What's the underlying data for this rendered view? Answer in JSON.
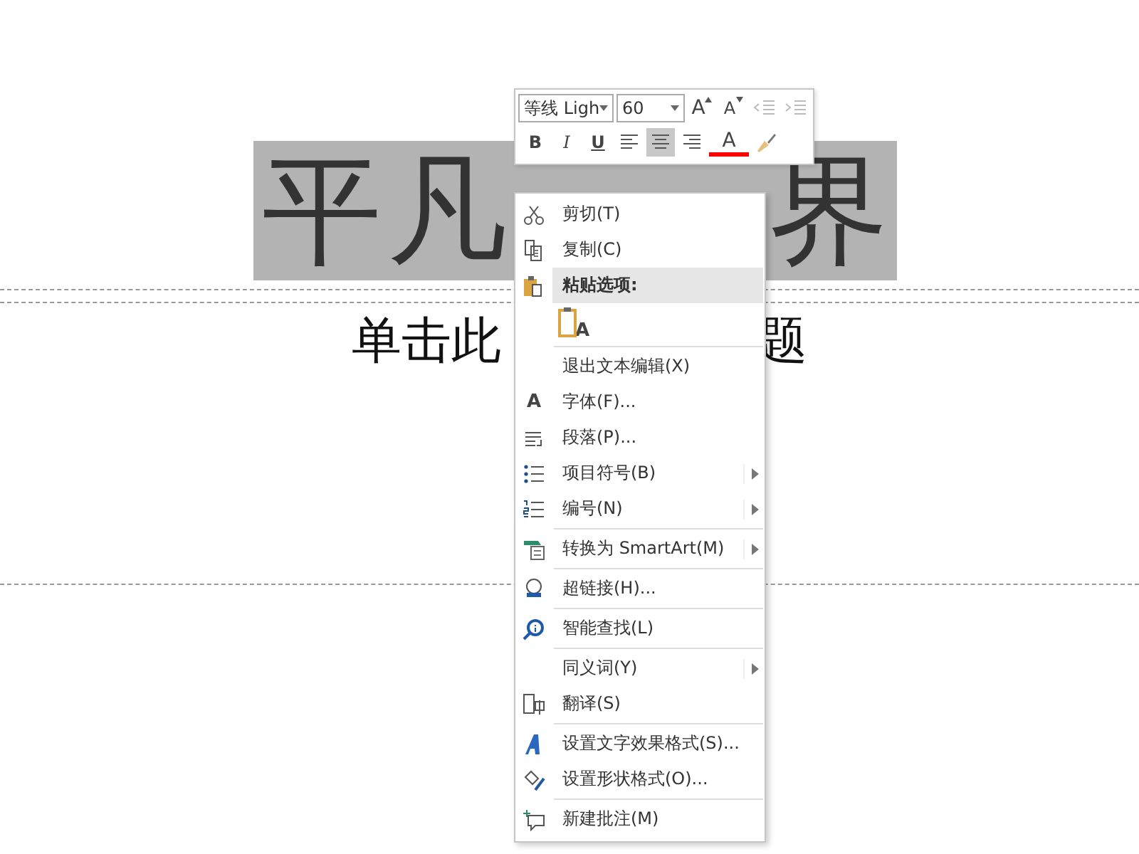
{
  "slide": {
    "title_left": "平凡",
    "title_right": "界",
    "title_selected": true,
    "subtitle_left": "单击此",
    "subtitle_right": "题"
  },
  "mini_toolbar": {
    "font_name": "等线 Ligh",
    "font_size": "60",
    "row_1": [
      {
        "kind": "grow",
        "label": "A",
        "disabled": false
      },
      {
        "kind": "shrink",
        "label": "A",
        "disabled": false
      },
      {
        "kind": "outdent",
        "disabled": true
      },
      {
        "kind": "indent",
        "disabled": true
      }
    ],
    "row_2": [
      {
        "kind": "bold",
        "label": "B",
        "selected": false
      },
      {
        "kind": "italic",
        "label": "I",
        "selected": false
      },
      {
        "kind": "underline",
        "label": "U",
        "selected": false
      },
      {
        "kind": "align-left",
        "selected": false
      },
      {
        "kind": "align-center",
        "selected": true
      },
      {
        "kind": "align-right",
        "selected": false
      },
      {
        "kind": "font-color",
        "label": "A",
        "color": "#ff0000"
      },
      {
        "kind": "painter"
      }
    ]
  },
  "context_menu": [
    {
      "kind": "item",
      "label": "剪切(T)",
      "submenu": false,
      "divider": false
    },
    {
      "kind": "item",
      "label": "复制(C)",
      "submenu": false,
      "divider": false
    },
    {
      "kind": "header",
      "label": "粘贴选项:",
      "divider": false
    },
    {
      "kind": "paste-option",
      "label": "A",
      "divider": false
    },
    {
      "kind": "item",
      "label": "退出文本编辑(X)",
      "submenu": false,
      "divider": true
    },
    {
      "kind": "item",
      "glyph": "A",
      "label": "字体(F)...",
      "submenu": false,
      "divider": false
    },
    {
      "kind": "item",
      "label": "段落(P)...",
      "submenu": false,
      "divider": false
    },
    {
      "kind": "item",
      "label": "项目符号(B)",
      "submenu": true,
      "divider": false
    },
    {
      "kind": "item",
      "label": "编号(N)",
      "submenu": true,
      "divider": false
    },
    {
      "kind": "item",
      "label": "转换为 SmartArt(M)",
      "submenu": true,
      "divider": true
    },
    {
      "kind": "item",
      "label": "超链接(H)...",
      "submenu": false,
      "divider": true
    },
    {
      "kind": "item",
      "label": "智能查找(L)",
      "submenu": false,
      "divider": true
    },
    {
      "kind": "item",
      "label": "同义词(Y)",
      "submenu": true,
      "divider": true
    },
    {
      "kind": "item",
      "label": "翻译(S)",
      "submenu": false,
      "divider": false
    },
    {
      "kind": "item",
      "label": "设置文字效果格式(S)...",
      "submenu": false,
      "divider": true
    },
    {
      "kind": "item",
      "label": "设置形状格式(O)...",
      "submenu": false,
      "divider": false
    },
    {
      "kind": "item",
      "label": "新建批注(M)",
      "submenu": false,
      "divider": true
    }
  ]
}
